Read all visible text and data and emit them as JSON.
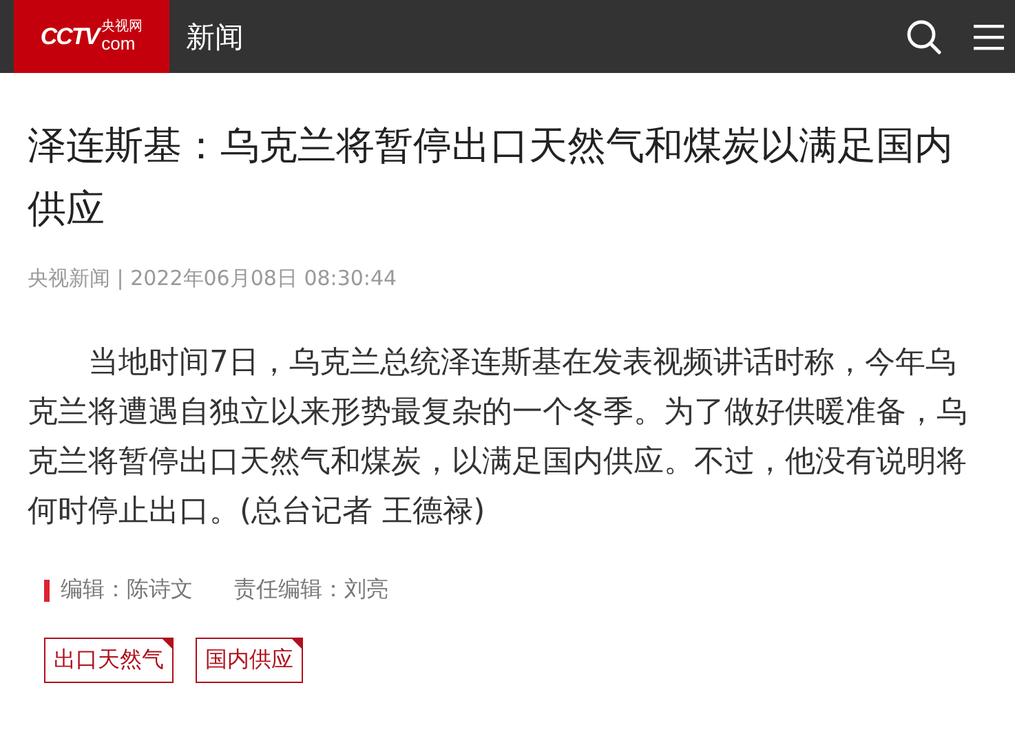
{
  "header": {
    "logo": {
      "mark": "CCTV",
      "domain": "com",
      "cn": "央视网"
    },
    "section": "新闻"
  },
  "article": {
    "title": "泽连斯基：乌克兰将暂停出口天然气和煤炭以满足国内供应",
    "meta": "央视新闻 | 2022年06月08日 08:30:44",
    "paragraphs": [
      "当地时间7日，乌克兰总统泽连斯基在发表视频讲话时称，今年乌克兰将遭遇自独立以来形势最复杂的一个冬季。为了做好供暖准备，乌克兰将暂停出口天然气和煤炭，以满足国内供应。不过，他没有说明将何时停止出口。(总台记者 王德禄)"
    ],
    "editors": [
      "编辑：陈诗文",
      "责任编辑：刘亮"
    ],
    "tags": [
      "出口天然气",
      "国内供应"
    ]
  }
}
